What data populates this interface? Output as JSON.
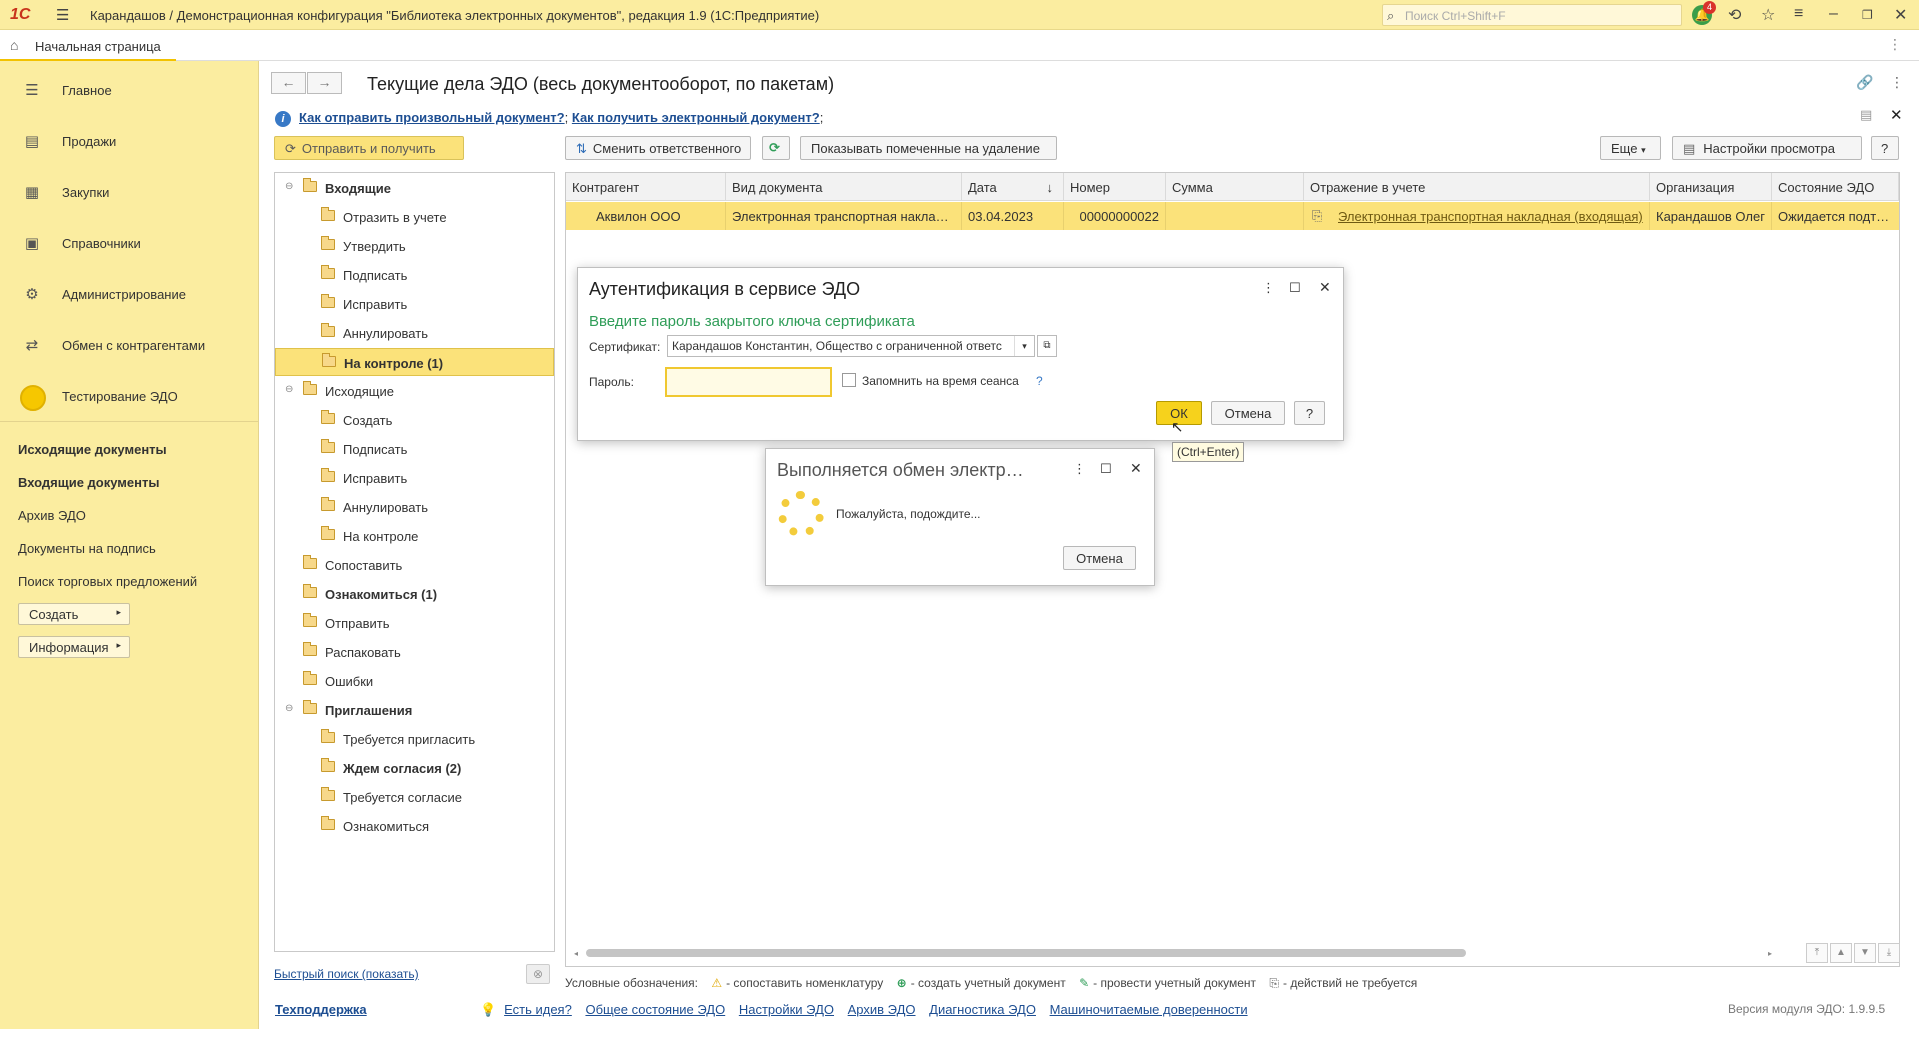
{
  "titlebar": {
    "logo": "1С",
    "title": "Карандашов / Демонстрационная конфигурация \"Библиотека электронных документов\", редакция 1.9  (1С:Предприятие)",
    "search_placeholder": "Поиск Ctrl+Shift+F",
    "notification_count": "4"
  },
  "tabs": {
    "home": "Начальная страница"
  },
  "sidebar": {
    "items": [
      {
        "label": "Главное",
        "icon": "menu-icon"
      },
      {
        "label": "Продажи",
        "icon": "sales-icon"
      },
      {
        "label": "Закупки",
        "icon": "purchases-icon"
      },
      {
        "label": "Справочники",
        "icon": "catalogs-icon"
      },
      {
        "label": "Администрирование",
        "icon": "gear-icon"
      },
      {
        "label": "Обмен с контрагентами",
        "icon": "exchange-icon"
      },
      {
        "label": "Тестирование ЭДО",
        "icon": "yellow-circle-icon"
      }
    ],
    "links": [
      {
        "label": "Исходящие документы",
        "bold": true
      },
      {
        "label": "Входящие документы",
        "bold": true
      },
      {
        "label": "Архив ЭДО",
        "bold": false
      },
      {
        "label": "Документы на подпись",
        "bold": false
      },
      {
        "label": "Поиск торговых предложений",
        "bold": false
      }
    ],
    "create_label": "Создать",
    "info_label": "Информация"
  },
  "header": {
    "title": "Текущие дела ЭДО (весь документооборот, по пакетам)",
    "link1": "Как отправить произвольный документ?",
    "link2": "Как получить электронный документ?",
    "sep": ";"
  },
  "toolbar": {
    "send_receive": "Отправить и получить",
    "change_responsible": "Сменить ответственного",
    "show_deleted": "Показывать помеченные на удаление",
    "more": "Еще",
    "view_settings": "Настройки просмотра",
    "help": "?"
  },
  "tree": [
    {
      "label": "Входящие",
      "level": 0,
      "bold": true,
      "toggle": "⊖"
    },
    {
      "label": "Отразить в учете",
      "level": 1
    },
    {
      "label": "Утвердить",
      "level": 1
    },
    {
      "label": "Подписать",
      "level": 1
    },
    {
      "label": "Исправить",
      "level": 1
    },
    {
      "label": "Аннулировать",
      "level": 1
    },
    {
      "label": "На контроле (1)",
      "level": 1,
      "bold": true,
      "selected": true
    },
    {
      "label": "Исходящие",
      "level": 0,
      "toggle": "⊖"
    },
    {
      "label": "Создать",
      "level": 1
    },
    {
      "label": "Подписать",
      "level": 1
    },
    {
      "label": "Исправить",
      "level": 1
    },
    {
      "label": "Аннулировать",
      "level": 1
    },
    {
      "label": "На контроле",
      "level": 1
    },
    {
      "label": "Сопоставить",
      "level": 0
    },
    {
      "label": "Ознакомиться (1)",
      "level": 0,
      "bold": true
    },
    {
      "label": "Отправить",
      "level": 0
    },
    {
      "label": "Распаковать",
      "level": 0
    },
    {
      "label": "Ошибки",
      "level": 0
    },
    {
      "label": "Приглашения",
      "level": 0,
      "bold": true,
      "toggle": "⊖"
    },
    {
      "label": "Требуется пригласить",
      "level": 1
    },
    {
      "label": "Ждем согласия (2)",
      "level": 1,
      "bold": true
    },
    {
      "label": "Требуется согласие",
      "level": 1
    },
    {
      "label": "Ознакомиться",
      "level": 1
    }
  ],
  "quick_search": "Быстрый поиск (показать)",
  "grid": {
    "columns": [
      "Контрагент",
      "Вид документа",
      "Дата",
      "Номер",
      "Сумма",
      "Отражение в учете",
      "Организация",
      "Состояние ЭДО"
    ],
    "sort_indicator": "↓",
    "rows": [
      [
        "Аквилон ООО",
        "Электронная транспортная накладная (входящая)",
        "03.04.2023",
        "00000000022",
        "",
        "Электронная транспортная накладная (входящая)",
        "Карандашов Олег",
        "Ожидается подтверждение"
      ]
    ]
  },
  "auth_dialog": {
    "title": "Аутентификация в сервисе ЭДО",
    "prompt": "Введите пароль закрытого ключа сертификата",
    "cert_label": "Сертификат:",
    "cert_value": "Карандашов Константин, Общество с ограниченной ответственностью",
    "password_label": "Пароль:",
    "password_value": "",
    "remember_label": "Запомнить на время сеанса",
    "remember_help": "?",
    "ok": "ОК",
    "cancel": "Отмена",
    "help": "?",
    "tooltip": "(Ctrl+Enter)",
    "accent_color": "#2f9d58"
  },
  "wait_dialog": {
    "title": "Выполняется обмен электр…",
    "message": "Пожалуйста, подождите...",
    "cancel": "Отмена"
  },
  "legend": {
    "prefix": "Условные обозначения:",
    "items": [
      {
        "icon": "warning-icon",
        "text": "- сопоставить номенклатуру"
      },
      {
        "icon": "plus-icon",
        "text": "- создать учетный документ"
      },
      {
        "icon": "post-icon",
        "text": "- провести учетный документ"
      },
      {
        "icon": "no-action-icon",
        "text": "- действий не требуется"
      }
    ]
  },
  "footer": {
    "support": "Техподдержка",
    "links": [
      "Есть идея?",
      "Общее состояние ЭДО",
      "Настройки ЭДО",
      "Архив ЭДО",
      "Диагностика ЭДО",
      "Машиночитаемые доверенности"
    ],
    "version": "Версия модуля ЭДО: 1.9.9.5"
  }
}
